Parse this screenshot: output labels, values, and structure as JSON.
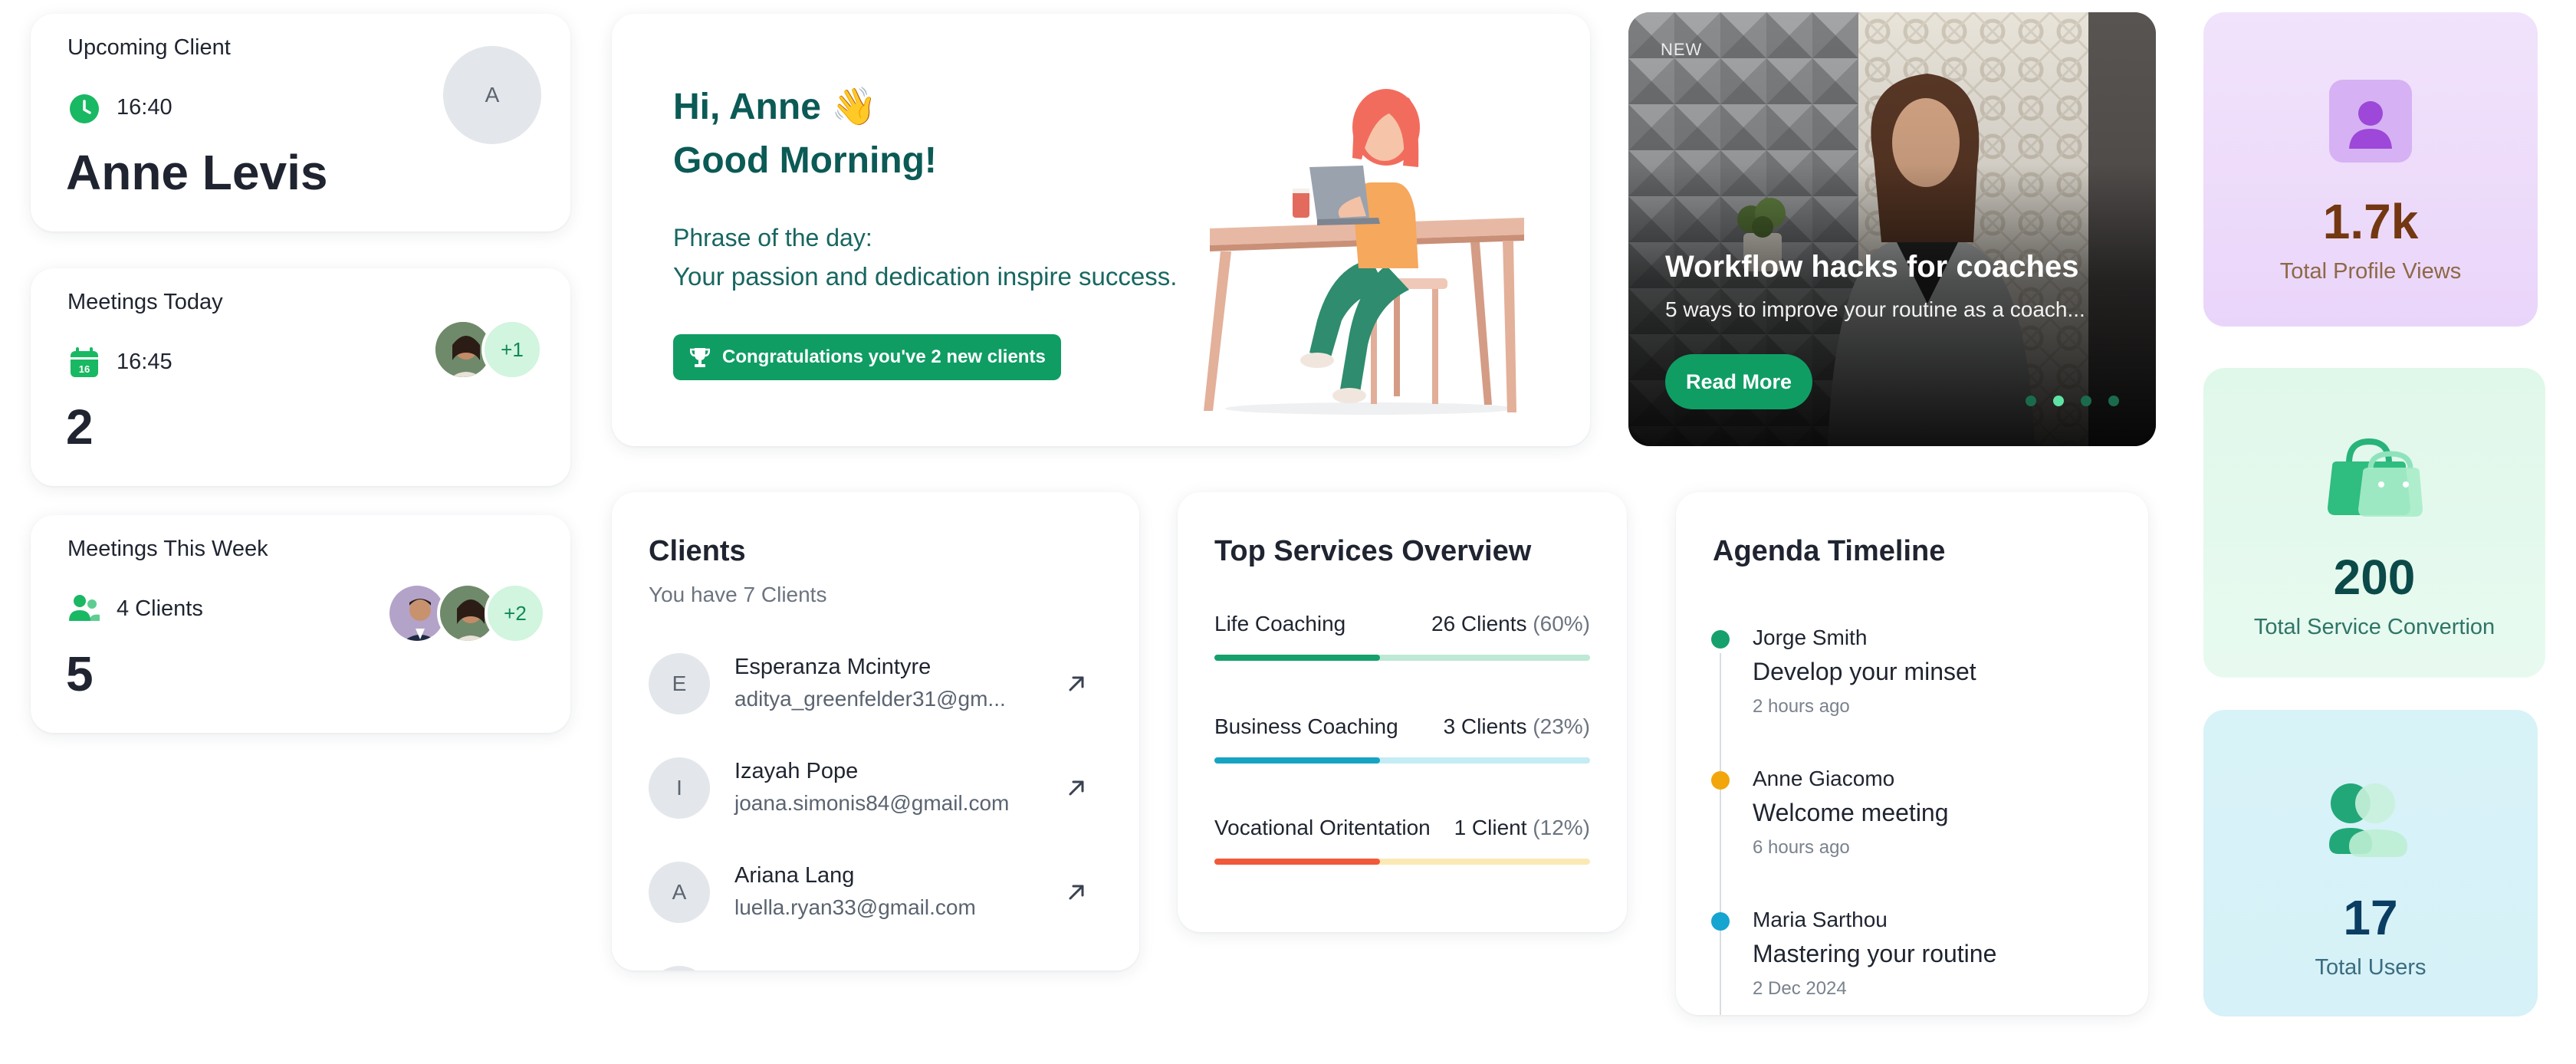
{
  "upcoming": {
    "label": "Upcoming Client",
    "time": "16:40",
    "name": "Anne Levis",
    "avatar_letter": "A"
  },
  "meetings_today": {
    "label": "Meetings Today",
    "time": "16:45",
    "count": "2",
    "extra": "+1"
  },
  "meetings_week": {
    "label": "Meetings This Week",
    "clients": "4 Clients",
    "count": "5",
    "extra": "+2"
  },
  "greeting": {
    "hi": "Hi, Anne 👋",
    "morning": "Good Morning!",
    "phrase_label": "Phrase of the day:",
    "phrase": "Your passion and dedication inspire success.",
    "badge": "Congratulations you've 2 new clients"
  },
  "promo": {
    "tag": "NEW",
    "title": "Workflow hacks for coaches",
    "subtitle": "5 ways to improve your routine as a coach...",
    "button": "Read More"
  },
  "clients": {
    "title": "Clients",
    "subtitle": "You have 7 Clients",
    "items": [
      {
        "letter": "E",
        "name": "Esperanza Mcintyre",
        "email": "aditya_greenfelder31@gm..."
      },
      {
        "letter": "I",
        "name": "Izayah Pope",
        "email": "joana.simonis84@gmail.com"
      },
      {
        "letter": "A",
        "name": "Ariana Lang",
        "email": "luella.ryan33@gmail.com"
      }
    ]
  },
  "services": {
    "title": "Top Services Overview",
    "items": [
      {
        "name": "Life Coaching",
        "count": "26 Clients",
        "pct": "(60%)",
        "value": 0.44,
        "color": "#16a06c",
        "track": "#bde9d6"
      },
      {
        "name": "Business Coaching",
        "count": "3 Clients",
        "pct": "(23%)",
        "value": 0.44,
        "color": "#16a4c2",
        "track": "#c3ecf4"
      },
      {
        "name": "Vocational Oritentation",
        "count": "1 Client",
        "pct": "(12%)",
        "value": 0.44,
        "color": "#f0593a",
        "track": "#fbe9b5"
      }
    ]
  },
  "agenda": {
    "title": "Agenda Timeline",
    "items": [
      {
        "person": "Jorge Smith",
        "event": "Develop your minset",
        "time": "2 hours ago",
        "color": "#16a06c"
      },
      {
        "person": "Anne Giacomo",
        "event": "Welcome meeting",
        "time": "6 hours ago",
        "color": "#f2a60c"
      },
      {
        "person": "Maria Sarthou",
        "event": "Mastering your routine",
        "time": "2 Dec 2024",
        "color": "#16a4d0"
      }
    ]
  },
  "stats": {
    "views": {
      "value": "1.7k",
      "label": "Total Profile Views"
    },
    "services": {
      "value": "200",
      "label": "Total Service Convertion"
    },
    "users": {
      "value": "17",
      "label": "Total Users"
    }
  }
}
